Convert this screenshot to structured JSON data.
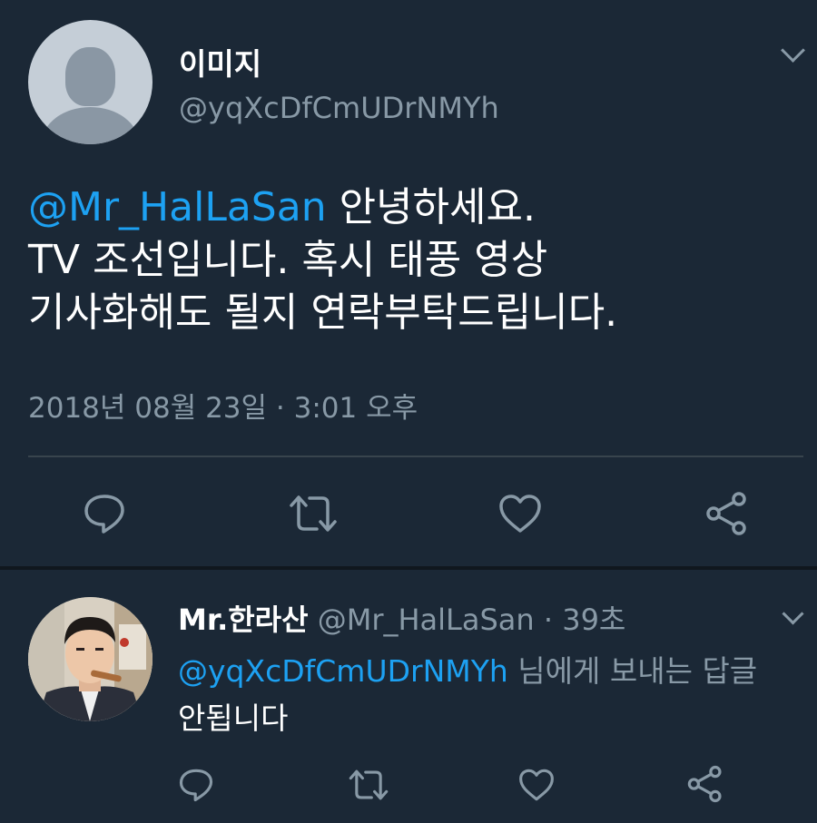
{
  "main_tweet": {
    "display_name": "이미지",
    "handle": "@yqXcDfCmUDrNMYh",
    "body": {
      "mention": "@Mr_HalLaSan",
      "line1_rest": " 안녕하세요.",
      "line2": "TV 조선입니다. 혹시 태풍 영상",
      "line3": "기사화해도 될지 연락부탁드립니다."
    },
    "timestamp": "2018년 08월 23일 · 3:01 오후",
    "actions": [
      "reply-icon",
      "retweet-icon",
      "like-icon",
      "share-icon"
    ]
  },
  "reply_tweet": {
    "display_name": "Mr.한라산",
    "meta": " @Mr_HalLaSan · 39초",
    "mention": "@yqXcDfCmUDrNMYh",
    "line1_rest": " 님에게 보내는 답글",
    "line2": "안됩니다",
    "actions": [
      "reply-icon",
      "retweet-icon",
      "like-icon",
      "share-icon"
    ]
  },
  "colors": {
    "background": "#1b2836",
    "accent": "#1da1f2",
    "secondary_text": "#8899a6",
    "divider": "#38444d"
  }
}
